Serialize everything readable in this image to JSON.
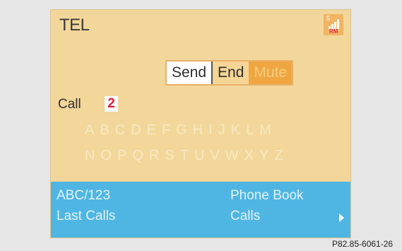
{
  "screen": {
    "title": "TEL",
    "status": {
      "signal_sub": "5",
      "roaming": "RM",
      "icon": "signal-strength-icon"
    },
    "buttons": {
      "send": "Send",
      "end": "End",
      "mute": "Mute"
    },
    "call": {
      "label": "Call",
      "number": "2"
    },
    "keyboard": {
      "row1": [
        "A",
        "B",
        "C",
        "D",
        "E",
        "F",
        "G",
        "H",
        "I",
        "J",
        "K",
        "L",
        "M"
      ],
      "row2": [
        "N",
        "O",
        "P",
        "Q",
        "R",
        "S",
        "T",
        "U",
        "V",
        "W",
        "X",
        "Y",
        "Z"
      ]
    },
    "menu": {
      "abc": "ABC/123",
      "last_calls": "Last Calls",
      "phone_book": "Phone Book",
      "calls": "Calls"
    }
  },
  "caption": "P82.85-6061-26"
}
